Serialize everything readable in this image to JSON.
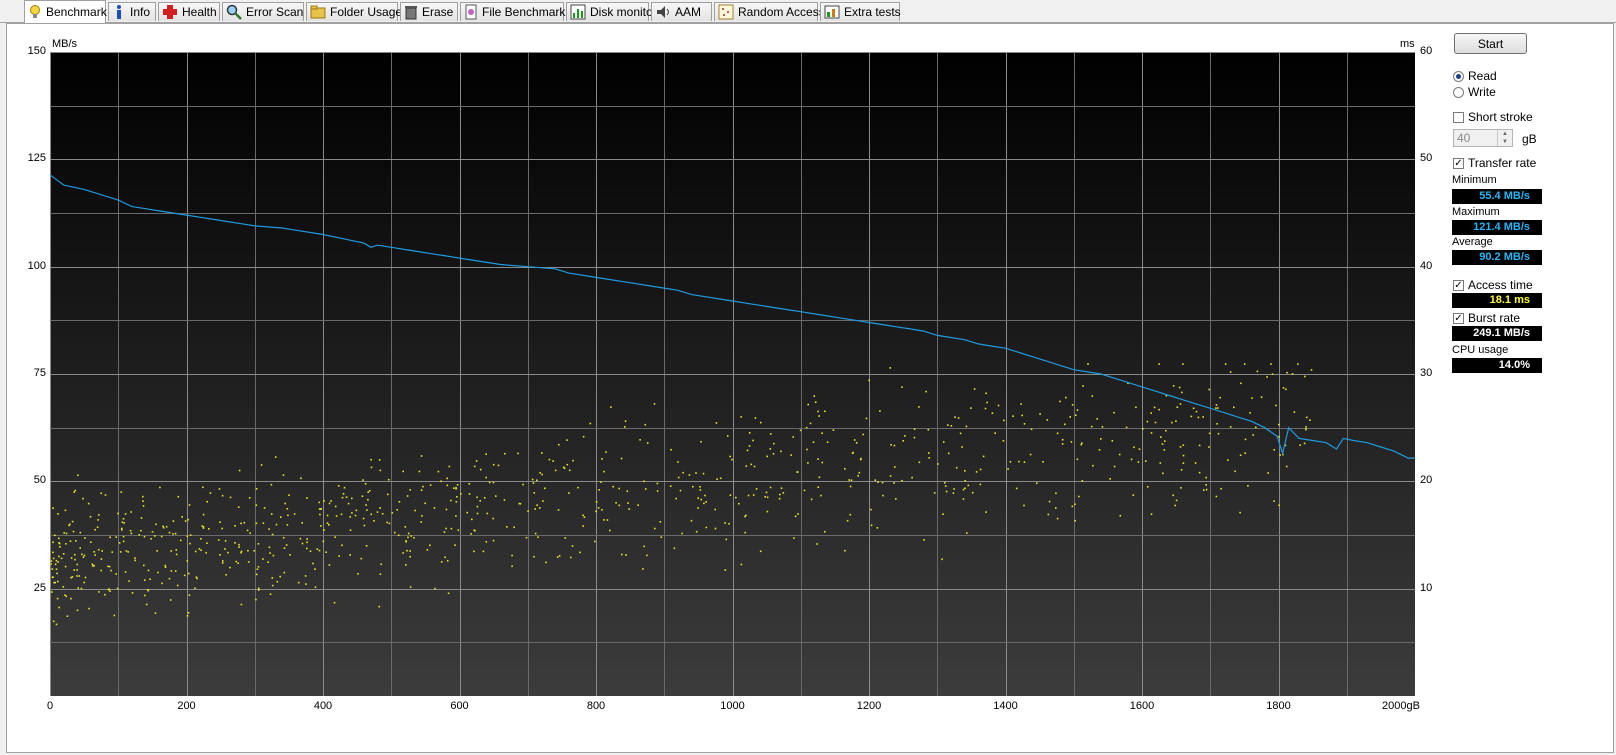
{
  "tabs": [
    {
      "label": "Benchmark",
      "icon": "bulb-icon",
      "active": true
    },
    {
      "label": "Info",
      "icon": "info-icon",
      "active": false
    },
    {
      "label": "Health",
      "icon": "health-cross-icon",
      "active": false
    },
    {
      "label": "Error Scan",
      "icon": "magnifier-icon",
      "active": false
    },
    {
      "label": "Folder Usage",
      "icon": "folder-icon",
      "active": false
    },
    {
      "label": "Erase",
      "icon": "trash-icon",
      "active": false
    },
    {
      "label": "File Benchmark",
      "icon": "file-benchmark-icon",
      "active": false
    },
    {
      "label": "Disk monitor",
      "icon": "disk-monitor-icon",
      "active": false
    },
    {
      "label": "AAM",
      "icon": "speaker-icon",
      "active": false
    },
    {
      "label": "Random Access",
      "icon": "random-access-icon",
      "active": false
    },
    {
      "label": "Extra tests",
      "icon": "extra-tests-icon",
      "active": false
    }
  ],
  "controls": {
    "start_label": "Start",
    "read_label": "Read",
    "write_label": "Write",
    "mode": "Read",
    "short_stroke_label": "Short stroke",
    "short_stroke_checked": false,
    "short_stroke_value": "40",
    "short_stroke_unit": "gB",
    "transfer_rate_label": "Transfer rate",
    "transfer_rate_checked": true,
    "access_time_label": "Access time",
    "access_time_checked": true,
    "burst_rate_label": "Burst rate",
    "burst_rate_checked": true
  },
  "stats": {
    "minimum_label": "Minimum",
    "minimum_value": "55.4 MB/s",
    "maximum_label": "Maximum",
    "maximum_value": "121.4 MB/s",
    "average_label": "Average",
    "average_value": "90.2 MB/s",
    "access_time_value": "18.1 ms",
    "burst_rate_value": "249.1 MB/s",
    "cpu_usage_label": "CPU usage",
    "cpu_usage_value": "14.0%"
  },
  "colors": {
    "transfer_line": "#1e9be0",
    "access_points": "#e6e626",
    "value_cyan": "#29b6f6",
    "value_yellow": "#ffff33",
    "value_white": "#ffffff"
  },
  "chart_data": {
    "type": "line",
    "left_unit": "MB/s",
    "right_unit": "ms",
    "x_unit": "gB",
    "ylim": [
      0,
      150
    ],
    "y2lim": [
      0,
      60
    ],
    "xlim": [
      0,
      2000
    ],
    "y_ticks": [
      "150",
      "125",
      "100",
      "75",
      "50",
      "25"
    ],
    "y2_ticks": [
      "60",
      "50",
      "40",
      "30",
      "20",
      "10"
    ],
    "x_ticks": [
      "0",
      "200",
      "400",
      "600",
      "800",
      "1000",
      "1200",
      "1400",
      "1600",
      "1800",
      "2000gB"
    ],
    "grid": true,
    "series": [
      {
        "name": "Transfer rate",
        "axis": "left",
        "x": [
          0,
          20,
          50,
          80,
          100,
          120,
          140,
          160,
          180,
          200,
          220,
          240,
          260,
          280,
          300,
          340,
          360,
          400,
          430,
          460,
          470,
          480,
          500,
          520,
          540,
          560,
          580,
          600,
          640,
          660,
          700,
          740,
          760,
          800,
          820,
          840,
          860,
          880,
          900,
          920,
          940,
          960,
          980,
          1000,
          1020,
          1040,
          1060,
          1080,
          1100,
          1120,
          1140,
          1160,
          1180,
          1200,
          1220,
          1240,
          1260,
          1280,
          1300,
          1320,
          1340,
          1360,
          1380,
          1400,
          1420,
          1440,
          1460,
          1480,
          1500,
          1520,
          1540,
          1560,
          1580,
          1600,
          1620,
          1640,
          1660,
          1680,
          1700,
          1720,
          1740,
          1760,
          1780,
          1798,
          1806,
          1815,
          1830,
          1850,
          1870,
          1885,
          1895,
          1910,
          1930,
          1950,
          1970,
          1990,
          2000
        ],
        "values": [
          121.4,
          119,
          118,
          116.5,
          115.5,
          114,
          113.5,
          113,
          112.5,
          112,
          111.5,
          111,
          110.5,
          110,
          109.5,
          109,
          108.5,
          107.5,
          106.5,
          105.5,
          104.5,
          105,
          104.5,
          104,
          103.5,
          103,
          102.5,
          102,
          101,
          100.5,
          100,
          99.5,
          98.5,
          97.5,
          97,
          96.5,
          96,
          95.5,
          95,
          94.5,
          93.5,
          93,
          92.5,
          92,
          91.5,
          91,
          90.5,
          90,
          89.5,
          89,
          88.5,
          88,
          87.5,
          87,
          86.5,
          86,
          85.5,
          85,
          84,
          83.5,
          83,
          82,
          81.5,
          81,
          80,
          79,
          78,
          77,
          76,
          75.5,
          75,
          74,
          73,
          72,
          71,
          70,
          69,
          68,
          67,
          66,
          65,
          64,
          62.5,
          60.5,
          56.5,
          62.5,
          60,
          59.5,
          59,
          57.5,
          60,
          59.5,
          59,
          58,
          57,
          55.4,
          55.4
        ]
      },
      {
        "name": "Access time",
        "axis": "right",
        "type": "scatter",
        "count": 900,
        "y_range_ms": [
          6,
          31
        ],
        "average_ms": 18.1
      }
    ]
  }
}
